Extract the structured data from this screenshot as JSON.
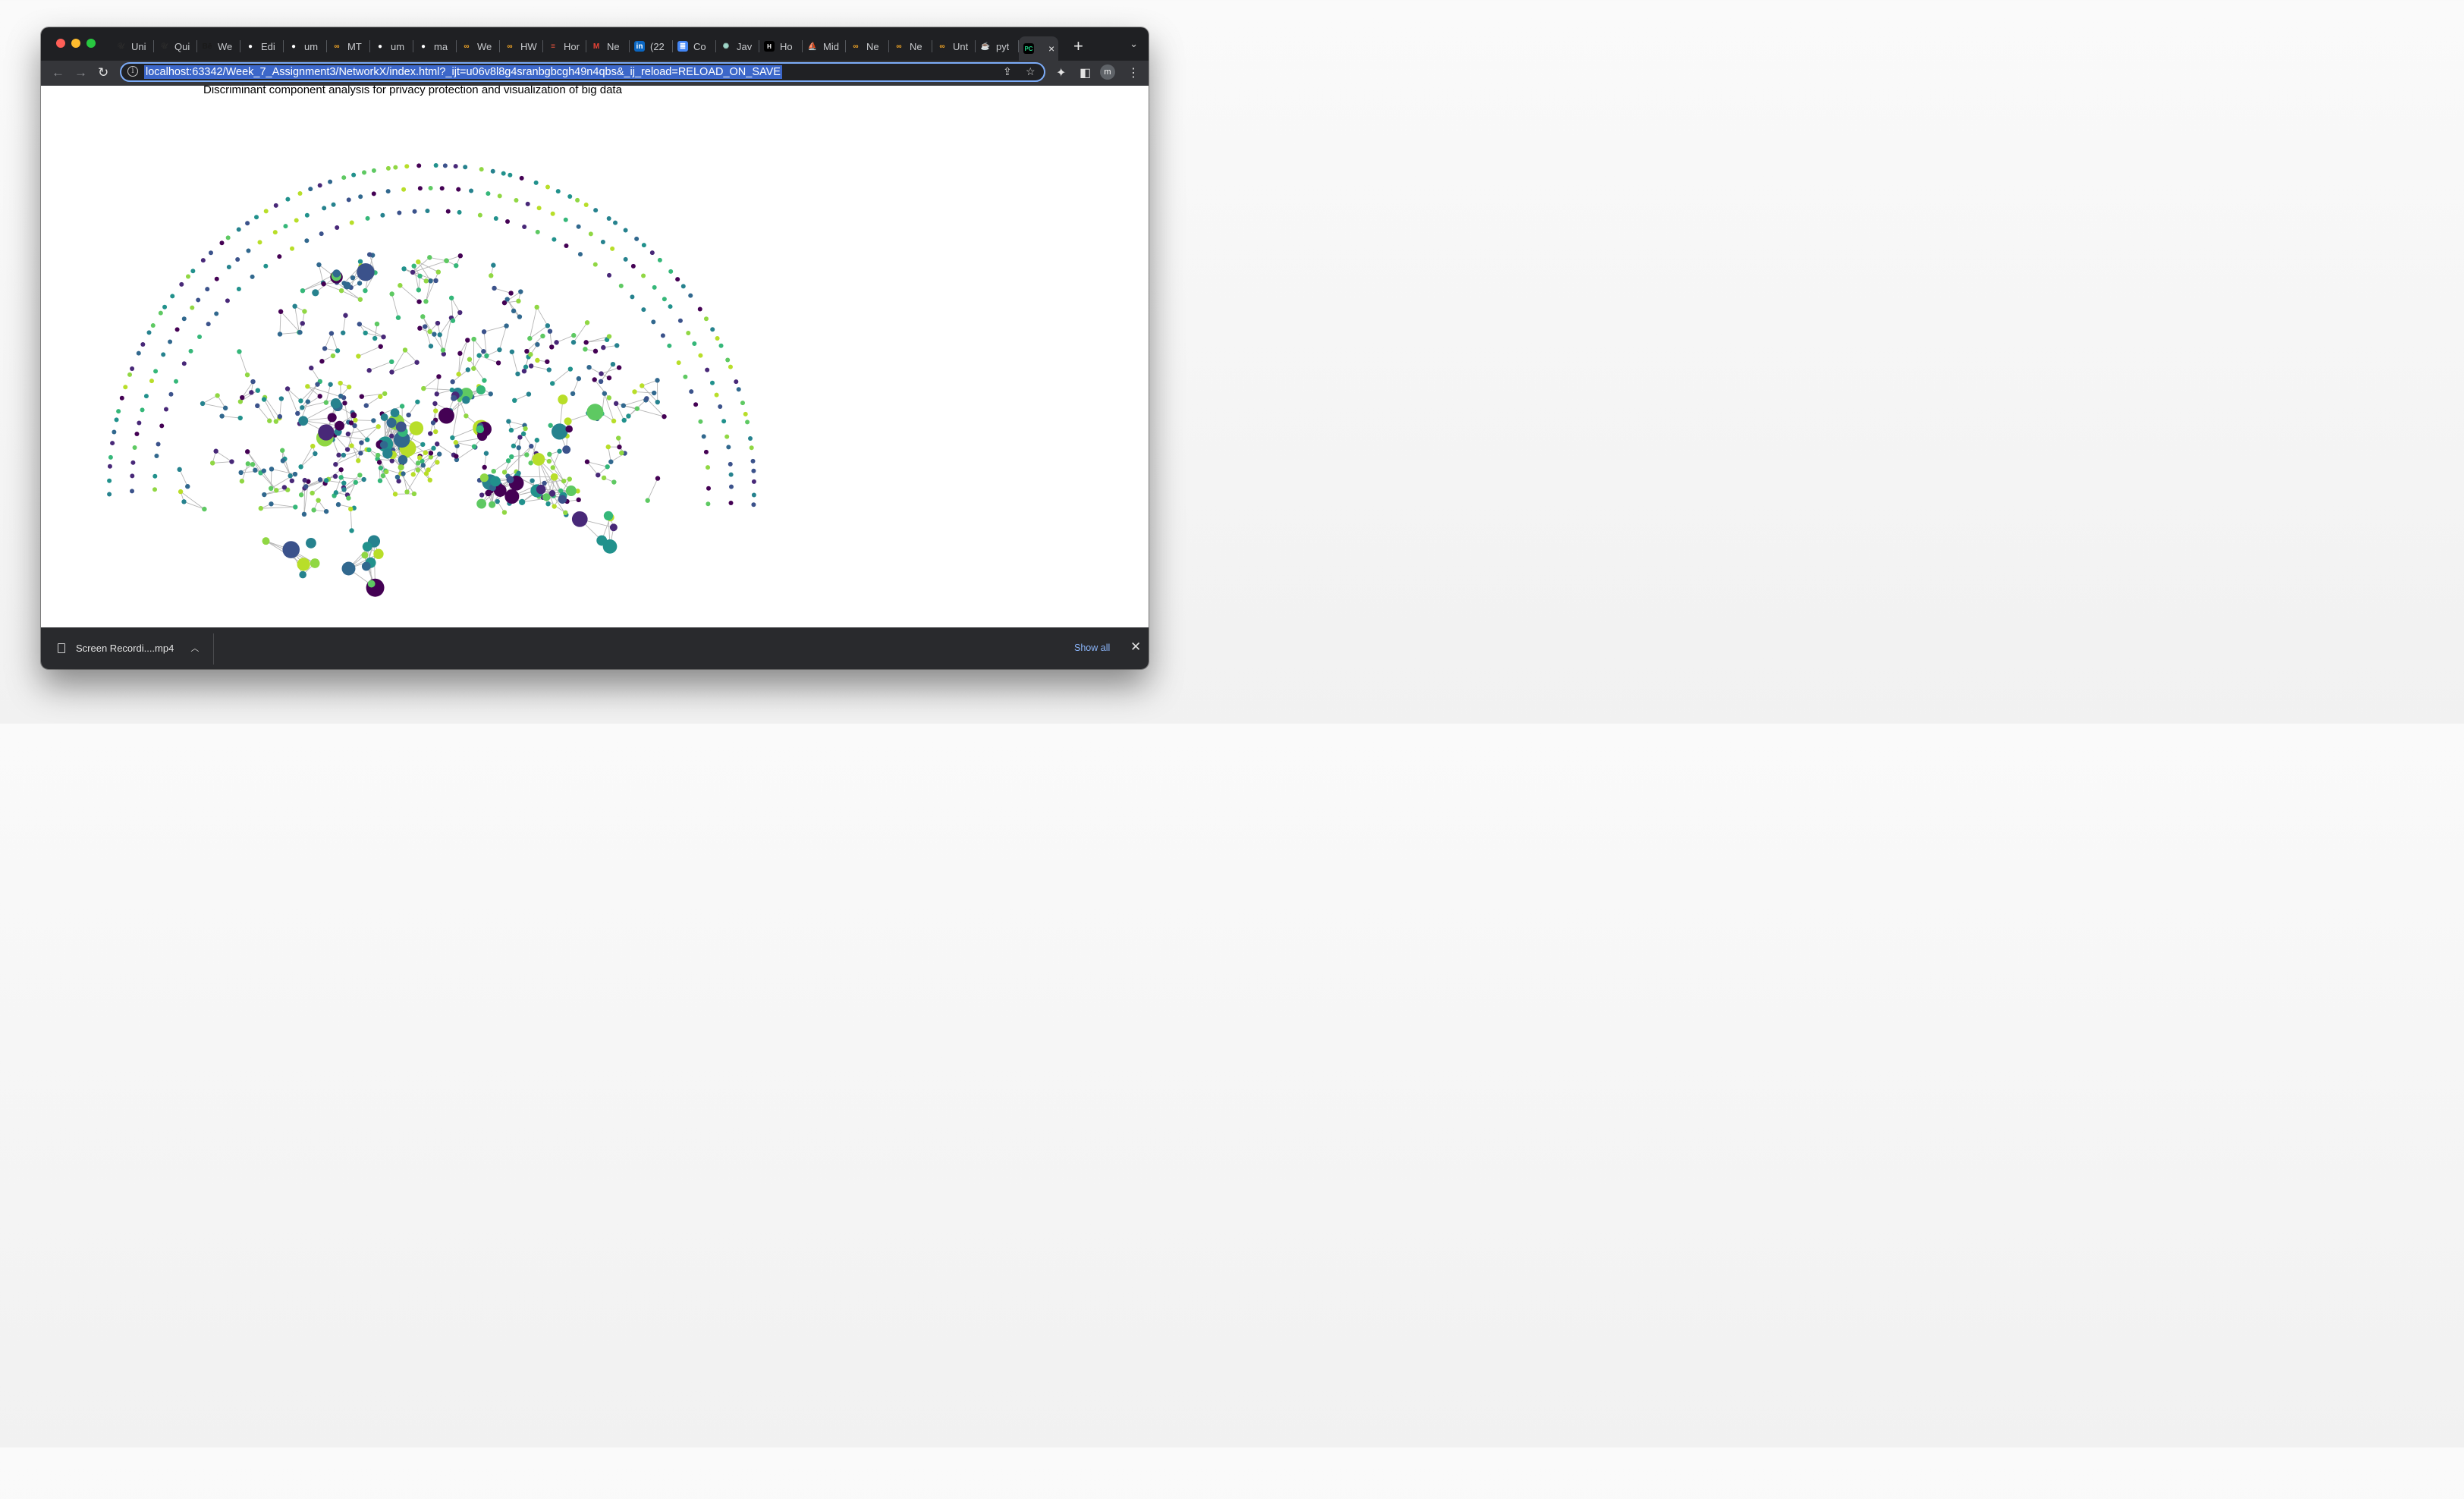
{
  "browser": {
    "tabs": [
      {
        "label": "Uni",
        "icon": "u-script-icon",
        "color": "#2b2b2b"
      },
      {
        "label": "Qui",
        "icon": "u-script-icon",
        "color": "#2b2b2b"
      },
      {
        "label": "We",
        "icon": "behance-icon",
        "color": "#1a1a1a"
      },
      {
        "label": "Edi",
        "icon": "github-icon",
        "color": "#ffffff"
      },
      {
        "label": "um",
        "icon": "github-icon",
        "color": "#ffffff"
      },
      {
        "label": "MT",
        "icon": "infinity-icon",
        "color": "#f7a825"
      },
      {
        "label": "um",
        "icon": "github-icon",
        "color": "#ffffff"
      },
      {
        "label": "ma",
        "icon": "github-icon",
        "color": "#ffffff"
      },
      {
        "label": "We",
        "icon": "infinity-icon",
        "color": "#f7a825"
      },
      {
        "label": "HW",
        "icon": "infinity-icon",
        "color": "#f7a825"
      },
      {
        "label": "Hor",
        "icon": "stack-icon",
        "color": "#e5533d"
      },
      {
        "label": "Ne",
        "icon": "gmail-icon",
        "color": "#ea4335"
      },
      {
        "label": "(22",
        "icon": "linkedin-icon",
        "color": "#0a66c2"
      },
      {
        "label": "Co",
        "icon": "docs-icon",
        "color": "#4285f4"
      },
      {
        "label": "Jav",
        "icon": "openai-icon",
        "color": "#9fd6c8"
      },
      {
        "label": "Ho",
        "icon": "htg-icon",
        "color": "#111111"
      },
      {
        "label": "Mid",
        "icon": "sailboat-icon",
        "color": "#6b8cff"
      },
      {
        "label": "Ne",
        "icon": "infinity-icon",
        "color": "#f7a825"
      },
      {
        "label": "Ne",
        "icon": "infinity-icon",
        "color": "#f7a825"
      },
      {
        "label": "Unt",
        "icon": "infinity-icon",
        "color": "#f7a825"
      },
      {
        "label": "pyt",
        "icon": "java-cup-icon",
        "color": "#e76f00"
      }
    ],
    "active_tab": {
      "icon": "pycharm-icon",
      "close": "×"
    },
    "new_tab": "+",
    "tab_list": "⌄",
    "url": "localhost:63342/Week_7_Assignment3/NetworkX/index.html?_ijt=u06v8l8g4sranbgbcgh49n4qbs&_ij_reload=RELOAD_ON_SAVE",
    "avatar_letter": "m",
    "accent": "#7cacf8"
  },
  "page": {
    "title": "Discriminant component analysis for privacy protection and visualization of big data",
    "palette": [
      "#440154",
      "#3b528b",
      "#21918c",
      "#5ec962",
      "#b8de29",
      "#482878",
      "#31688e",
      "#35b779",
      "#90d743",
      "#26828e"
    ]
  },
  "downloads": {
    "file": "Screen Recordi....mp4",
    "show_all": "Show all",
    "close": "✕"
  }
}
